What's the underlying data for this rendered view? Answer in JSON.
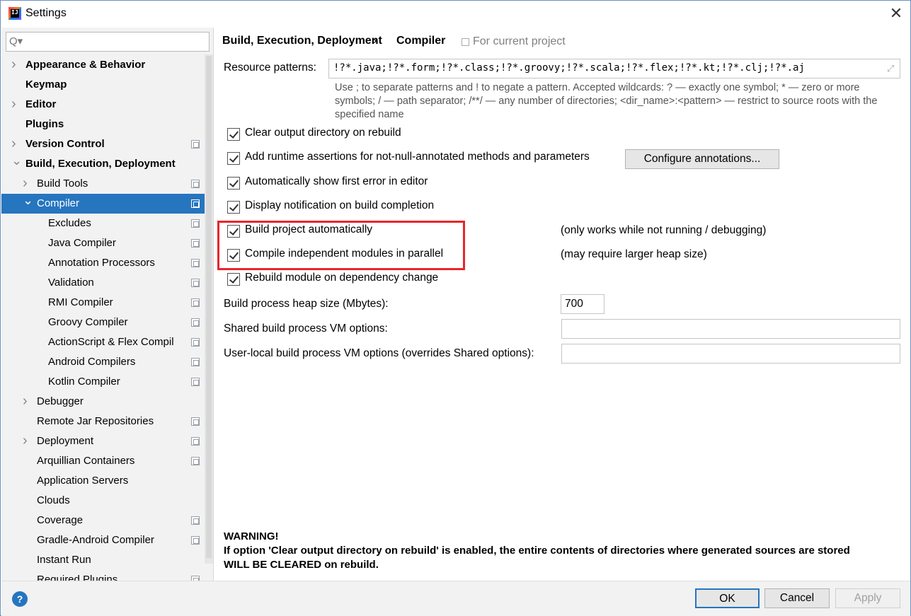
{
  "window": {
    "title": "Settings",
    "app_icon_text": "IJ",
    "close_glyph": "✕"
  },
  "sidebar": {
    "search": {
      "value": "",
      "placeholder": "",
      "glyph": "Q▾"
    },
    "items": [
      {
        "label": "Appearance & Behavior",
        "level": 0,
        "expandable": true,
        "expanded": false,
        "bold": true,
        "project_icon": false
      },
      {
        "label": "Keymap",
        "level": 0,
        "expandable": false,
        "bold": true,
        "project_icon": false
      },
      {
        "label": "Editor",
        "level": 0,
        "expandable": true,
        "expanded": false,
        "bold": true,
        "project_icon": false
      },
      {
        "label": "Plugins",
        "level": 0,
        "expandable": false,
        "bold": true,
        "project_icon": false
      },
      {
        "label": "Version Control",
        "level": 0,
        "expandable": true,
        "expanded": false,
        "bold": true,
        "project_icon": true
      },
      {
        "label": "Build, Execution, Deployment",
        "level": 0,
        "expandable": true,
        "expanded": true,
        "bold": true,
        "project_icon": false
      },
      {
        "label": "Build Tools",
        "level": 1,
        "expandable": true,
        "expanded": false,
        "project_icon": true
      },
      {
        "label": "Compiler",
        "level": 1,
        "expandable": true,
        "expanded": true,
        "selected": true,
        "project_icon": true
      },
      {
        "label": "Excludes",
        "level": 2,
        "project_icon": true
      },
      {
        "label": "Java Compiler",
        "level": 2,
        "project_icon": true
      },
      {
        "label": "Annotation Processors",
        "level": 2,
        "project_icon": true
      },
      {
        "label": "Validation",
        "level": 2,
        "project_icon": true
      },
      {
        "label": "RMI Compiler",
        "level": 2,
        "project_icon": true
      },
      {
        "label": "Groovy Compiler",
        "level": 2,
        "project_icon": true
      },
      {
        "label": "ActionScript & Flex Compil",
        "level": 2,
        "project_icon": true
      },
      {
        "label": "Android Compilers",
        "level": 2,
        "project_icon": true
      },
      {
        "label": "Kotlin Compiler",
        "level": 2,
        "project_icon": true
      },
      {
        "label": "Debugger",
        "level": 1,
        "expandable": true,
        "expanded": false,
        "project_icon": false
      },
      {
        "label": "Remote Jar Repositories",
        "level": 1,
        "project_icon": true
      },
      {
        "label": "Deployment",
        "level": 1,
        "expandable": true,
        "expanded": false,
        "project_icon": true
      },
      {
        "label": "Arquillian Containers",
        "level": 1,
        "project_icon": true
      },
      {
        "label": "Application Servers",
        "level": 1,
        "project_icon": false
      },
      {
        "label": "Clouds",
        "level": 1,
        "project_icon": false
      },
      {
        "label": "Coverage",
        "level": 1,
        "project_icon": true
      },
      {
        "label": "Gradle-Android Compiler",
        "level": 1,
        "project_icon": true
      },
      {
        "label": "Instant Run",
        "level": 1,
        "project_icon": false
      },
      {
        "label": "Required Plugins",
        "level": 1,
        "project_icon": true
      }
    ]
  },
  "breadcrumb": {
    "parent": "Build, Execution, Deployment",
    "separator": "›",
    "current": "Compiler",
    "scope": "For current project"
  },
  "resource_patterns": {
    "label": "Resource patterns:",
    "value": "!?*.java;!?*.form;!?*.class;!?*.groovy;!?*.scala;!?*.flex;!?*.kt;!?*.clj;!?*.aj",
    "expand_glyph": "⤢",
    "help": "Use ; to separate patterns and ! to negate a pattern. Accepted wildcards: ? — exactly one symbol; * — zero or more symbols; / — path separator; /**/ — any number of directories; <dir_name>:<pattern> — restrict to source roots with the specified name"
  },
  "options": [
    {
      "label": "Clear output directory on rebuild",
      "checked": true
    },
    {
      "label": "Add runtime assertions for not-null-annotated methods and parameters",
      "checked": true
    },
    {
      "label": "Automatically show first error in editor",
      "checked": true
    },
    {
      "label": "Display notification on build completion",
      "checked": true
    },
    {
      "label": "Build project automatically",
      "checked": true,
      "note": "(only works while not running / debugging)"
    },
    {
      "label": "Compile independent modules in parallel",
      "checked": true,
      "note": "(may require larger heap size)"
    },
    {
      "label": "Rebuild module on dependency change",
      "checked": true
    }
  ],
  "configure_annotations_label": "Configure annotations...",
  "heap": {
    "label": "Build process heap size (Mbytes):",
    "value": "700"
  },
  "shared_vm": {
    "label": "Shared build process VM options:",
    "value": ""
  },
  "user_vm": {
    "label": "User-local build process VM options (overrides Shared options):",
    "value": ""
  },
  "warning": {
    "title": "WARNING!",
    "line1": "If option 'Clear output directory on rebuild' is enabled, the entire contents of directories where generated sources are stored",
    "line2": "WILL BE CLEARED on rebuild."
  },
  "buttons": {
    "help": "?",
    "ok": "OK",
    "cancel": "Cancel",
    "apply": "Apply"
  },
  "colors": {
    "selection": "#2675bf",
    "highlight_box": "#e8262a",
    "sidebar_bg": "#f2f2f2"
  }
}
